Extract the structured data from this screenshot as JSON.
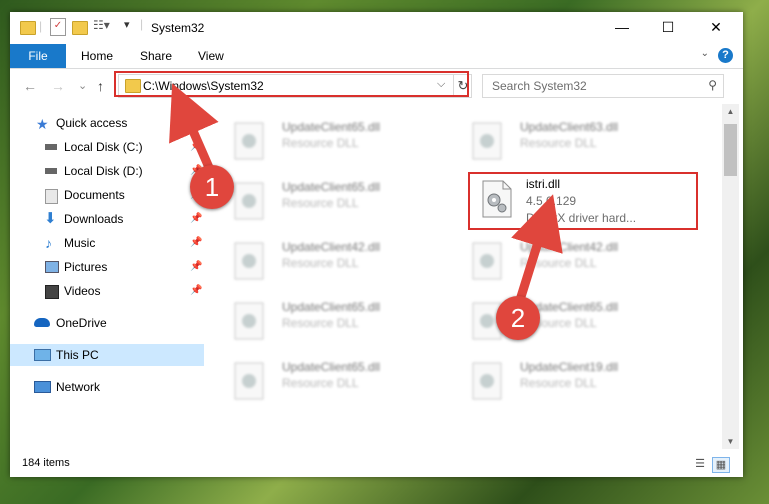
{
  "window": {
    "title": "System32",
    "controls": {
      "minimize": "—",
      "maximize": "☐",
      "close": "✕"
    }
  },
  "ribbon": {
    "tabs": [
      "File",
      "Home",
      "Share",
      "View"
    ],
    "help": "?"
  },
  "navigation": {
    "back_icon": "←",
    "forward_icon": "→",
    "recent_icon": "⌄",
    "up_icon": "↑",
    "address": "C:\\Windows\\System32",
    "search_placeholder": "Search System32"
  },
  "sidebar": {
    "items": [
      {
        "label": "Quick access",
        "icon": "star-icon",
        "pinned": false
      },
      {
        "label": "Local Disk (C:)",
        "icon": "drive-icon",
        "pinned": true
      },
      {
        "label": "Local Disk (D:)",
        "icon": "drive-icon",
        "pinned": true
      },
      {
        "label": "Documents",
        "icon": "documents-icon",
        "pinned": true
      },
      {
        "label": "Downloads",
        "icon": "download-icon",
        "pinned": true
      },
      {
        "label": "Music",
        "icon": "music-icon",
        "pinned": true
      },
      {
        "label": "Pictures",
        "icon": "pictures-icon",
        "pinned": true
      },
      {
        "label": "Videos",
        "icon": "videos-icon",
        "pinned": true
      },
      {
        "label": "OneDrive",
        "icon": "cloud-icon",
        "pinned": false
      },
      {
        "label": "This PC",
        "icon": "computer-icon",
        "pinned": false,
        "selected": true
      },
      {
        "label": "Network",
        "icon": "network-icon",
        "pinned": false
      }
    ]
  },
  "files": [
    {
      "name": "UpdateClient65.dll",
      "desc": "Resource DLL",
      "blurred": true
    },
    {
      "name": "UpdateClient63.dll",
      "desc": "Resource DLL",
      "blurred": true
    },
    {
      "name": "UpdateClient65.dll",
      "desc": "Resource DLL",
      "blurred": true
    },
    {
      "name": "istri.dll",
      "version": "4.5.0.129",
      "desc": "DirectX driver hard...",
      "blurred": false
    },
    {
      "name": "UpdateClient42.dll",
      "desc": "Resource DLL",
      "blurred": true
    },
    {
      "name": "UpdateClient42.dll",
      "desc": "Resource DLL",
      "blurred": true
    },
    {
      "name": "UpdateClient65.dll",
      "desc": "Resource DLL",
      "blurred": true
    },
    {
      "name": "UpdateClient65.dll",
      "desc": "Resource DLL",
      "blurred": true
    },
    {
      "name": "UpdateClient65.dll",
      "desc": "Resource DLL",
      "blurred": true
    },
    {
      "name": "UpdateClient19.dll",
      "desc": "Resource DLL",
      "blurred": true
    }
  ],
  "status": {
    "item_count": "184 items"
  },
  "annotations": {
    "marker1": "1",
    "marker2": "2",
    "color": "#d9302c"
  }
}
